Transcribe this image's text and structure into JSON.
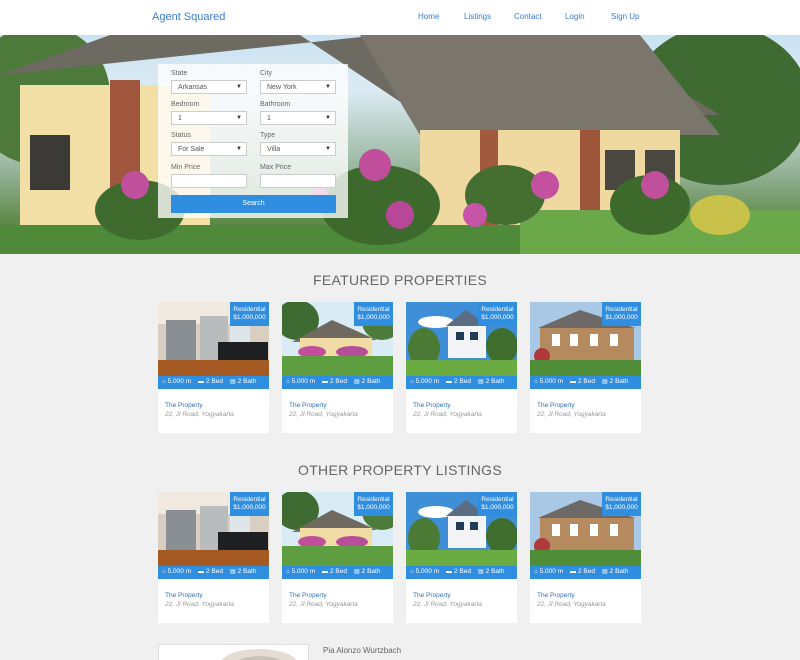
{
  "nav": {
    "brand": "Agent Squared",
    "links": [
      "Home",
      "Listings",
      "Contact",
      "Login",
      "Sign Up"
    ]
  },
  "search": {
    "state_label": "State",
    "state_value": "Arkansas",
    "city_label": "City",
    "city_value": "New York",
    "bedroom_label": "Bedroom",
    "bedroom_value": "1",
    "bathroom_label": "Bathroom",
    "bathroom_value": "1",
    "status_label": "Status",
    "status_value": "For Sale",
    "type_label": "Type",
    "type_value": "Villa",
    "min_price_label": "Min Price",
    "max_price_label": "Max Price",
    "button": "Search"
  },
  "featured": {
    "title": "FEATURED PROPERTIES",
    "cards": [
      {
        "type": "Residential",
        "price": "$1,000,000",
        "area": "5.000 m",
        "beds": "2 Bed",
        "baths": "2 Bath",
        "name": "The Property",
        "address": "22, Jl Road, Yogyakarta"
      },
      {
        "type": "Residential",
        "price": "$1,000,000",
        "area": "5.000 m",
        "beds": "2 Bed",
        "baths": "2 Bath",
        "name": "The Property",
        "address": "22, Jl Road, Yogyakarta"
      },
      {
        "type": "Residential",
        "price": "$1,000,000",
        "area": "5.000 m",
        "beds": "2 Bed",
        "baths": "2 Bath",
        "name": "The Property",
        "address": "22, Jl Road, Yogyakarta"
      },
      {
        "type": "Residential",
        "price": "$1,000,000",
        "area": "5.000 m",
        "beds": "2 Bed",
        "baths": "2 Bath",
        "name": "The Property",
        "address": "22, Jl Road, Yogyakarta"
      }
    ]
  },
  "other": {
    "title": "OTHER PROPERTY LISTINGS",
    "cards": [
      {
        "type": "Residential",
        "price": "$1,000,000",
        "area": "5.000 m",
        "beds": "2 Bed",
        "baths": "2 Bath",
        "name": "The Property",
        "address": "22, Jl Road, Yogyakarta"
      },
      {
        "type": "Residential",
        "price": "$1,000,000",
        "area": "5.000 m",
        "beds": "2 Bed",
        "baths": "2 Bath",
        "name": "The Property",
        "address": "22, Jl Road, Yogyakarta"
      },
      {
        "type": "Residential",
        "price": "$1,000,000",
        "area": "5.000 m",
        "beds": "2 Bed",
        "baths": "2 Bath",
        "name": "The Property",
        "address": "22, Jl Road, Yogyakarta"
      },
      {
        "type": "Residential",
        "price": "$1,000,000",
        "area": "5.000 m",
        "beds": "2 Bed",
        "baths": "2 Bath",
        "name": "The Property",
        "address": "22, Jl Road, Yogyakarta"
      }
    ]
  },
  "agent": {
    "name": "Pia Alonzo Wurtzbach"
  },
  "icons": {
    "area": "home-icon",
    "beds": "bed-icon",
    "baths": "bath-icon"
  },
  "colors": {
    "accent": "#2f8ee0",
    "link": "#3a7bd5",
    "background": "#f0f0f0"
  }
}
